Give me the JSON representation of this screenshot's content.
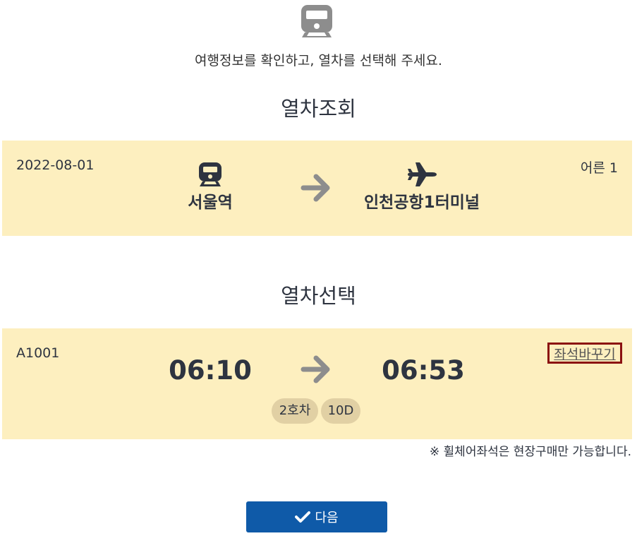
{
  "header": {
    "icon": "train-icon",
    "intro_text": "여행정보를 확인하고, 열차를 선택해 주세요."
  },
  "lookup": {
    "title": "열차조회",
    "date": "2022-08-01",
    "passengers": "어른 1",
    "from": {
      "icon": "train-icon",
      "name": "서울역"
    },
    "to": {
      "icon": "airplane-icon",
      "name": "인천공항1터미널"
    }
  },
  "selection": {
    "title": "열차선택",
    "train_no": "A1001",
    "departure": "06:10",
    "arrival": "06:53",
    "car": "2호차",
    "seat": "10D",
    "change_seat_label": "좌석바꾸기"
  },
  "notice": "※ 휠체어좌석은 현장구매만 가능합니다.",
  "next_button": {
    "label": "다음",
    "icon": "check-icon"
  },
  "colors": {
    "panel_bg": "#fdefbf",
    "pill_bg": "#e1d0a4",
    "primary": "#0f5aa8",
    "highlight_border": "#8b1111"
  }
}
